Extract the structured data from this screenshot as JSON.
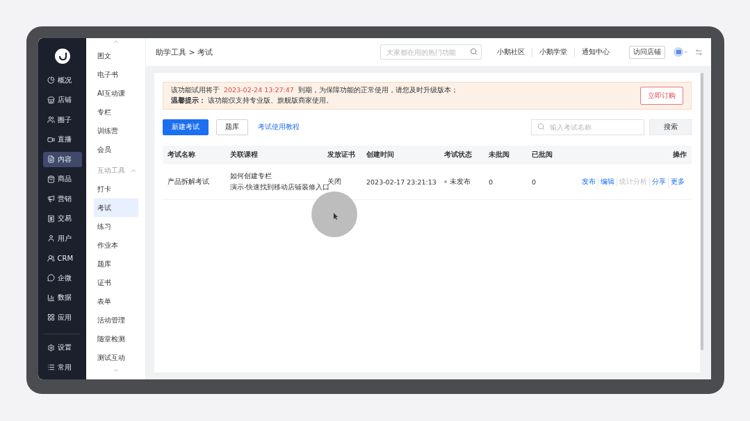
{
  "main_nav": [
    {
      "label": "概况",
      "selected": false
    },
    {
      "label": "店铺",
      "selected": false
    },
    {
      "label": "圈子",
      "selected": false
    },
    {
      "label": "直播",
      "selected": false
    },
    {
      "label": "内容",
      "selected": true
    },
    {
      "label": "商品",
      "selected": false
    },
    {
      "label": "营销",
      "selected": false
    },
    {
      "label": "交易",
      "selected": false
    },
    {
      "label": "用户",
      "selected": false
    },
    {
      "label": "CRM",
      "selected": false
    },
    {
      "label": "企微",
      "selected": false
    },
    {
      "label": "数据",
      "selected": false
    },
    {
      "label": "应用",
      "selected": false
    }
  ],
  "main_nav_bottom": [
    {
      "label": "设置",
      "selected": false
    },
    {
      "label": "常用",
      "selected": false
    }
  ],
  "sub_nav": {
    "items": [
      {
        "label": "图文",
        "selected": false
      },
      {
        "label": "电子书",
        "selected": false
      },
      {
        "label": "AI互动课",
        "selected": false
      },
      {
        "label": "专栏",
        "selected": false
      },
      {
        "label": "训练营",
        "selected": false
      },
      {
        "label": "会员",
        "selected": false
      }
    ],
    "group": {
      "label": "互动工具",
      "expanded": true,
      "items": [
        {
          "label": "打卡",
          "selected": false
        },
        {
          "label": "考试",
          "selected": true
        },
        {
          "label": "练习",
          "selected": false
        },
        {
          "label": "作业本",
          "selected": false
        },
        {
          "label": "题库",
          "selected": false
        },
        {
          "label": "证书",
          "selected": false
        },
        {
          "label": "表单",
          "selected": false
        },
        {
          "label": "活动管理",
          "selected": false
        },
        {
          "label": "随堂检测",
          "selected": false
        },
        {
          "label": "测试互动",
          "selected": false
        }
      ]
    }
  },
  "header": {
    "breadcrumb": "助学工具 > 考试",
    "search": {
      "placeholder": "大家都在用的热门功能"
    },
    "links": [
      "小鹅社区",
      "小鹅学堂",
      "通知中心"
    ],
    "visit_button": "访问店铺"
  },
  "notice": {
    "line1_before": "该功能试用将于",
    "line1_date": "2023-02-24 13:27:47",
    "line1_after": "到期，为保障功能的正常使用，请您及时升级版本；",
    "line2": "**温馨提示：** 该功能仅支持专业版、旗舰版商家使用。",
    "button": "立即订购"
  },
  "toolbar": {
    "primary_button": "新建考试",
    "secondary_button": "题库",
    "link": "考试使用教程",
    "search": {
      "placeholder": "输入考试名称"
    },
    "search_button": "搜索"
  },
  "table": {
    "columns": [
      "考试名称",
      "关联课程",
      "发放证书",
      "创建时间",
      "考试状态",
      "未批阅",
      "已批阅",
      "操作"
    ],
    "rows": [
      {
        "name": "产品拆解考试",
        "courses": [
          "如何创建专栏",
          "演示-快速找到移动店铺装修入口"
        ],
        "certificate": "关闭",
        "created": "2023-02-17 23:21:13",
        "status": "未发布",
        "unreviewed": "0",
        "reviewed": "0",
        "actions": [
          {
            "label": "发布",
            "disabled": false
          },
          {
            "label": "编辑",
            "disabled": false
          },
          {
            "label": "统计分析",
            "disabled": true
          },
          {
            "label": "分享",
            "disabled": false
          },
          {
            "label": "更多",
            "disabled": false
          }
        ]
      }
    ]
  }
}
